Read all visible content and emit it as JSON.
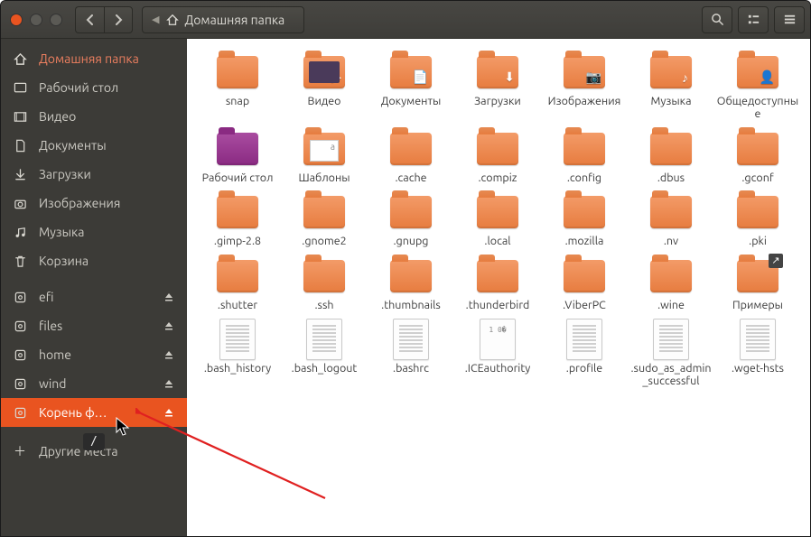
{
  "header": {
    "path_label": "Домашняя папка"
  },
  "sidebar": {
    "items": [
      {
        "label": "Домашняя папка",
        "icon": "home",
        "style": "home"
      },
      {
        "label": "Рабочий стол",
        "icon": "desktop"
      },
      {
        "label": "Видео",
        "icon": "video"
      },
      {
        "label": "Документы",
        "icon": "document"
      },
      {
        "label": "Загрузки",
        "icon": "download"
      },
      {
        "label": "Изображения",
        "icon": "camera"
      },
      {
        "label": "Музыка",
        "icon": "music"
      },
      {
        "label": "Корзина",
        "icon": "trash"
      }
    ],
    "mounts": [
      {
        "label": "efi"
      },
      {
        "label": "files"
      },
      {
        "label": "home"
      },
      {
        "label": "wind"
      },
      {
        "label": "Корень ф…",
        "active": true
      }
    ],
    "other_label": "Другие места"
  },
  "items": [
    {
      "label": "snap",
      "kind": "folder"
    },
    {
      "label": "Видео",
      "kind": "folder",
      "variant": "video",
      "overlay": "▶"
    },
    {
      "label": "Документы",
      "kind": "folder",
      "overlay": "📄"
    },
    {
      "label": "Загрузки",
      "kind": "folder",
      "overlay": "⬇"
    },
    {
      "label": "Изображения",
      "kind": "folder",
      "overlay": "📷"
    },
    {
      "label": "Музыка",
      "kind": "folder",
      "overlay": "♪"
    },
    {
      "label": "Общедоступные",
      "kind": "folder",
      "overlay": "👤"
    },
    {
      "label": "Рабочий стол",
      "kind": "folder",
      "variant": "desktop"
    },
    {
      "label": "Шаблоны",
      "kind": "folder",
      "variant": "templates"
    },
    {
      "label": ".cache",
      "kind": "folder"
    },
    {
      "label": ".compiz",
      "kind": "folder"
    },
    {
      "label": ".config",
      "kind": "folder"
    },
    {
      "label": ".dbus",
      "kind": "folder"
    },
    {
      "label": ".gconf",
      "kind": "folder"
    },
    {
      "label": ".gimp-2.8",
      "kind": "folder"
    },
    {
      "label": ".gnome2",
      "kind": "folder"
    },
    {
      "label": ".gnupg",
      "kind": "folder"
    },
    {
      "label": ".local",
      "kind": "folder"
    },
    {
      "label": ".mozilla",
      "kind": "folder"
    },
    {
      "label": ".nv",
      "kind": "folder"
    },
    {
      "label": ".pki",
      "kind": "folder"
    },
    {
      "label": ".shutter",
      "kind": "folder"
    },
    {
      "label": ".ssh",
      "kind": "folder"
    },
    {
      "label": ".thumbnails",
      "kind": "folder"
    },
    {
      "label": ".thunderbird",
      "kind": "folder"
    },
    {
      "label": ".ViberPC",
      "kind": "folder"
    },
    {
      "label": ".wine",
      "kind": "folder"
    },
    {
      "label": "Примеры",
      "kind": "folder",
      "link": true
    },
    {
      "label": ".bash_history",
      "kind": "file"
    },
    {
      "label": ".bash_logout",
      "kind": "file"
    },
    {
      "label": ".bashrc",
      "kind": "file"
    },
    {
      "label": ".ICEauthority",
      "kind": "file",
      "variant": "bin"
    },
    {
      "label": ".profile",
      "kind": "file"
    },
    {
      "label": ".sudo_as_admin_successful",
      "kind": "file"
    },
    {
      "label": ".wget-hsts",
      "kind": "file"
    }
  ],
  "tooltip": "/"
}
